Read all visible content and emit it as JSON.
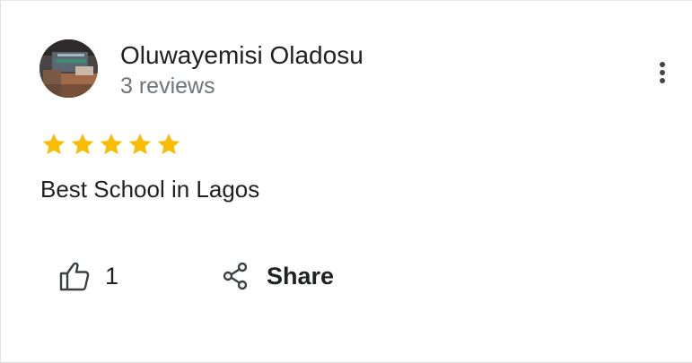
{
  "review": {
    "reviewer_name": "Oluwayemisi Oladosu",
    "reviewer_meta": "3 reviews",
    "rating": 5,
    "rating_max": 5,
    "text": "Best School in Lagos",
    "like_count": "1",
    "share_label": "Share"
  },
  "colors": {
    "star": "#fbbc04",
    "text_primary": "#202124",
    "text_secondary": "#70757a"
  },
  "icons": {
    "avatar": "reviewer-avatar-photo",
    "more": "more-vertical-icon",
    "like": "thumbs-up-icon",
    "share": "share-icon",
    "star": "star-icon"
  }
}
